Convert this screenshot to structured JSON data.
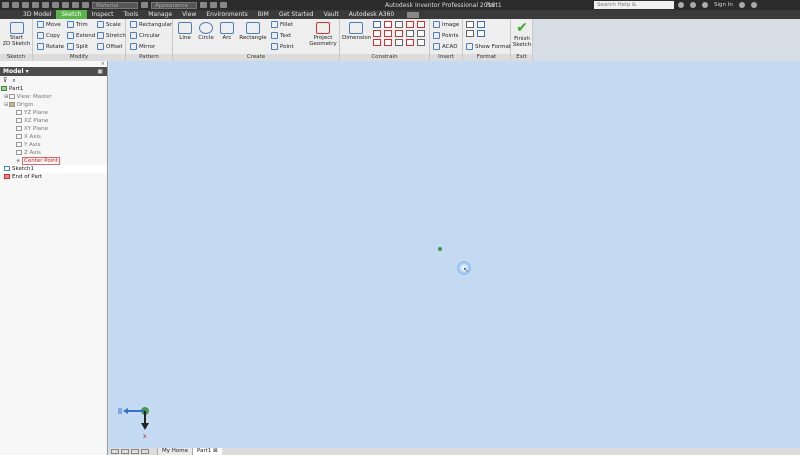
{
  "titlebar": {
    "material_placeholder": "Material",
    "appearance_placeholder": "Appearance",
    "app_title": "Autodesk Inventor Professional 2016",
    "document": "Part1",
    "search_placeholder": "Search Help & Commands...",
    "sign_in": "Sign In"
  },
  "tabs": [
    "3D Model",
    "Sketch",
    "Inspect",
    "Tools",
    "Manage",
    "View",
    "Environments",
    "BIM",
    "Get Started",
    "Vault",
    "Autodesk A360"
  ],
  "active_tab": "Sketch",
  "ribbon": {
    "sketch": {
      "start": "Start",
      "start2": "2D Sketch",
      "label": "Sketch"
    },
    "modify": {
      "move": "Move",
      "trim": "Trim",
      "scale": "Scale",
      "copy": "Copy",
      "extend": "Extend",
      "stretch": "Stretch",
      "rotate": "Rotate",
      "split": "Split",
      "offset": "Offset",
      "label": "Modify"
    },
    "pattern": {
      "rectangular": "Rectangular",
      "circular": "Circular",
      "mirror": "Mirror",
      "label": "Pattern"
    },
    "create": {
      "line": "Line",
      "circle": "Circle",
      "arc": "Arc",
      "rectangle": "Rectangle",
      "fillet": "Fillet",
      "text": "Text",
      "point": "Point",
      "project1": "Project",
      "project2": "Geometry",
      "label": "Create"
    },
    "constrain": {
      "dimension": "Dimension",
      "label": "Constrain"
    },
    "insert": {
      "image": "Image",
      "points": "Points",
      "acad": "ACAD",
      "label": "Insert"
    },
    "format": {
      "show_format": "Show Format",
      "label": "Format"
    },
    "exit": {
      "finish1": "Finish",
      "finish2": "Sketch",
      "label": "Exit"
    }
  },
  "browser": {
    "title": "Model",
    "nodes": {
      "part": "Part1",
      "view": "View: Master",
      "origin": "Origin",
      "yz": "YZ Plane",
      "xz": "XZ Plane",
      "xy": "XY Plane",
      "xaxis": "X Axis",
      "yaxis": "Y Axis",
      "zaxis": "Z Axis",
      "center": "Center Point",
      "sketch": "Sketch1",
      "end": "End of Part"
    }
  },
  "docbar": {
    "home": "My Home",
    "part": "Part1"
  },
  "colors": {
    "accent": "#59b449",
    "canvas": "#c4daf3"
  }
}
